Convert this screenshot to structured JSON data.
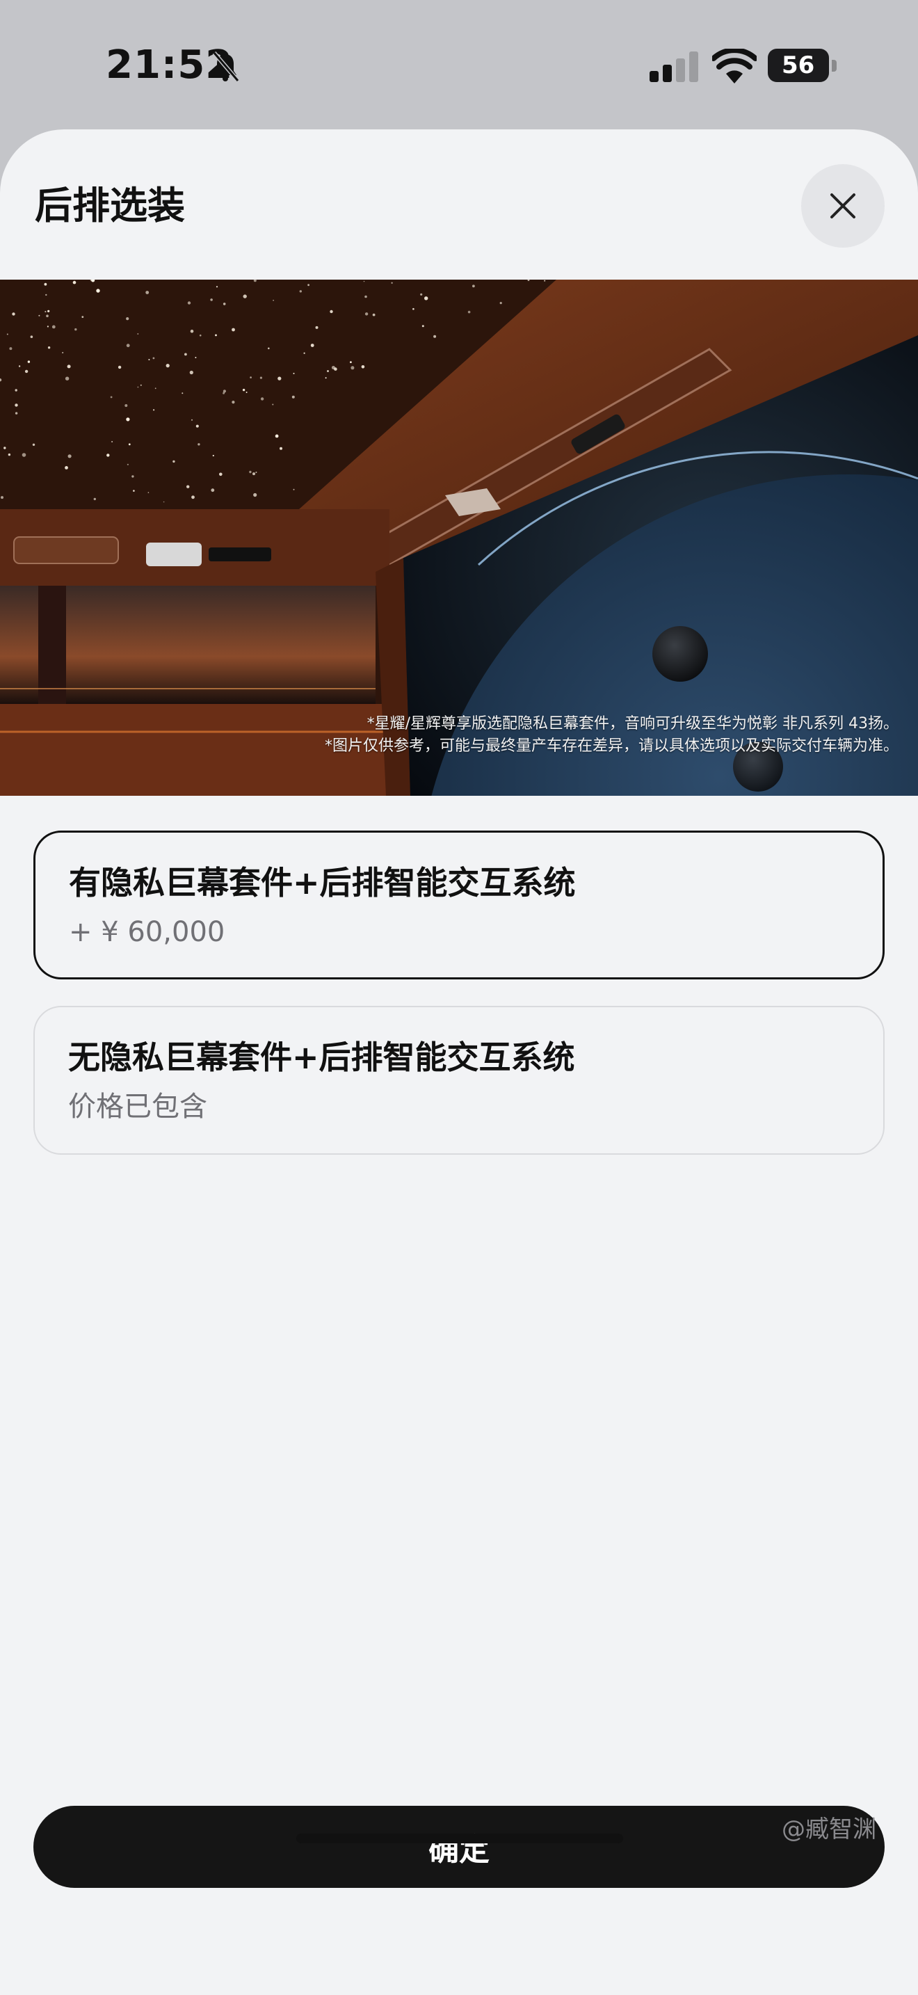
{
  "status_bar": {
    "time": "21:52",
    "battery": "56",
    "icons": [
      "bell-slash-icon",
      "cellular-signal-icon",
      "wifi-icon",
      "battery-icon"
    ]
  },
  "sheet": {
    "title": "后排选装",
    "close_icon": "close-icon"
  },
  "hero": {
    "caption_line1": "*星耀/星辉尊享版选配隐私巨幕套件，音响可升级至华为悦彰 非凡系列 43扬。",
    "caption_line2": "*图片仅供参考，可能与最终量产车存在差异，请以具体选项以及实际交付车辆为准。"
  },
  "options": [
    {
      "title": "有隐私巨幕套件+后排智能交互系统",
      "subtitle": "+ ¥ 60,000",
      "selected": true
    },
    {
      "title": "无隐私巨幕套件+后排智能交互系统",
      "subtitle": "价格已包含",
      "selected": false
    }
  ],
  "confirm_label": "确定",
  "watermark": "@臧智渊"
}
